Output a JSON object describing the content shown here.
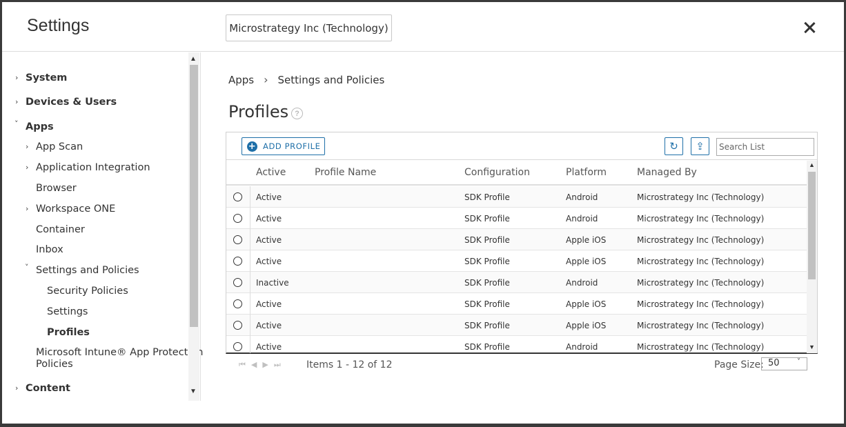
{
  "header": {
    "title": "Settings",
    "org_button": "Microstrategy Inc (Technology)"
  },
  "sidebar": {
    "items": [
      {
        "label": "System",
        "chevron": "›"
      },
      {
        "label": "Devices & Users",
        "chevron": "›"
      },
      {
        "label": "Apps",
        "chevron": "˅"
      },
      {
        "label": "App Scan",
        "chevron": "›"
      },
      {
        "label": "Application Integration",
        "chevron": "›"
      },
      {
        "label": "Browser"
      },
      {
        "label": "Workspace ONE",
        "chevron": "›"
      },
      {
        "label": "Container"
      },
      {
        "label": "Inbox"
      },
      {
        "label": "Settings and Policies",
        "chevron": "˅"
      },
      {
        "label": "Security Policies"
      },
      {
        "label": "Settings"
      },
      {
        "label": "Profiles"
      },
      {
        "label": "Microsoft Intune® App Protection"
      },
      {
        "label": "Policies"
      },
      {
        "label": "Content",
        "chevron": "›"
      }
    ]
  },
  "breadcrumb": {
    "apps": "Apps",
    "separator": "›",
    "current": "Settings and Policies"
  },
  "page": {
    "title": "Profiles",
    "help_icon": "?"
  },
  "toolbar": {
    "add_label": "ADD PROFILE",
    "refresh_icon": "↻",
    "export_icon": "⇪",
    "search_placeholder": "Search List"
  },
  "table": {
    "columns": [
      "Active",
      "Profile Name",
      "Configuration",
      "Platform",
      "Managed By"
    ],
    "rows": [
      {
        "active": "Active",
        "name": "",
        "config": "SDK Profile",
        "platform": "Android",
        "managed": "Microstrategy Inc (Technology)"
      },
      {
        "active": "Active",
        "name": "",
        "config": "SDK Profile",
        "platform": "Android",
        "managed": "Microstrategy Inc (Technology)"
      },
      {
        "active": "Active",
        "name": "",
        "config": "SDK Profile",
        "platform": "Apple iOS",
        "managed": "Microstrategy Inc (Technology)"
      },
      {
        "active": "Active",
        "name": "",
        "config": "SDK Profile",
        "platform": "Apple iOS",
        "managed": "Microstrategy Inc (Technology)"
      },
      {
        "active": "Inactive",
        "name": "",
        "config": "SDK Profile",
        "platform": "Android",
        "managed": "Microstrategy Inc (Technology)"
      },
      {
        "active": "Active",
        "name": "",
        "config": "SDK Profile",
        "platform": "Apple iOS",
        "managed": "Microstrategy Inc (Technology)"
      },
      {
        "active": "Active",
        "name": "",
        "config": "SDK Profile",
        "platform": "Apple iOS",
        "managed": "Microstrategy Inc (Technology)"
      },
      {
        "active": "Active",
        "name": "",
        "config": "SDK Profile",
        "platform": "Android",
        "managed": "Microstrategy Inc (Technology)"
      }
    ]
  },
  "pager": {
    "items_text": "Items 1 - 12 of 12",
    "page_size_label": "Page Size:",
    "page_size_value": "50"
  }
}
